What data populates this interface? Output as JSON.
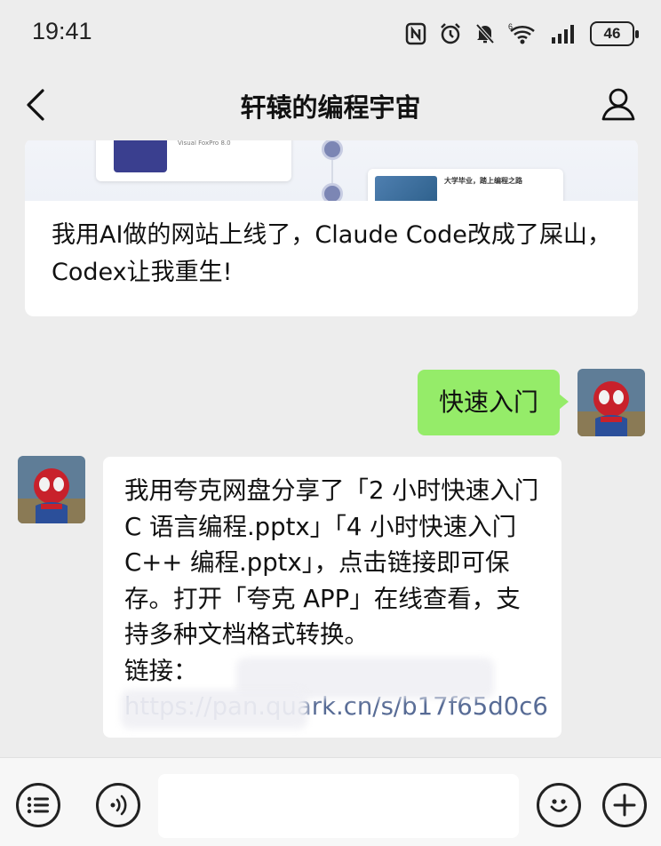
{
  "status_bar": {
    "time": "19:41",
    "battery": "46",
    "icons": [
      "nfc-icon",
      "alarm-icon",
      "mute-bell-icon",
      "wifi-6-icon",
      "signal-icon",
      "battery-icon"
    ]
  },
  "header": {
    "title": "轩辕的编程宇宙",
    "back_icon": "chevron-left-icon",
    "profile_icon": "person-icon"
  },
  "messages": [
    {
      "type": "article",
      "title": "我用AI做的网站上线了，Claude Code改成了屎山，Codex让我重生!",
      "thumbnail_texts": [
        "Visual FoxPro 8.0",
        "大学毕业，踏上编程之路"
      ]
    },
    {
      "type": "outgoing",
      "text": "快速入门"
    },
    {
      "type": "incoming",
      "text": "我用夸克网盘分享了「2 小时快速入门 C 语言编程.pptx」「4 小时快速入门 C++ 编程.pptx」，点击链接即可保存。打开「夸克 APP」在线查看，支持多种文档格式转换。",
      "link_label": "链接：",
      "link_text": "https://pan.quark.cn/s/b17f65d0c6"
    }
  ],
  "input_bar": {
    "menu_icon": "list-menu-icon",
    "voice_icon": "voice-icon",
    "emoji_icon": "smiley-icon",
    "plus_icon": "plus-icon",
    "input_value": ""
  },
  "colors": {
    "background": "#ededed",
    "outgoing_bubble": "#95ec69",
    "incoming_bubble": "#ffffff",
    "link": "#576b95"
  }
}
